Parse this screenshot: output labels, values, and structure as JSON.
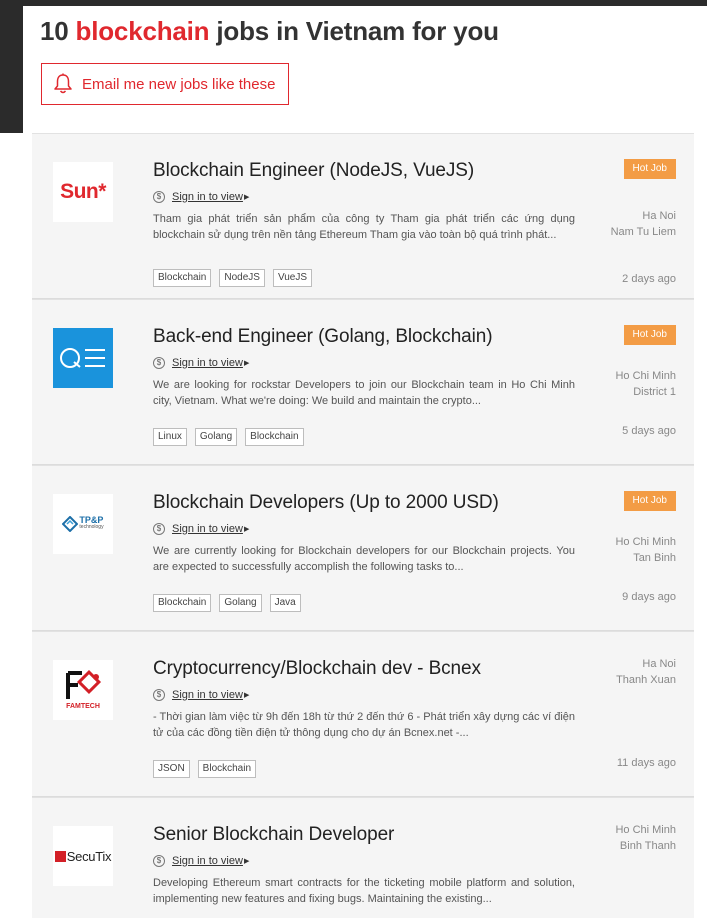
{
  "header": {
    "count_prefix": "10 ",
    "keyword": "blockchain",
    "suffix": " jobs in Vietnam for you",
    "email_button": "Email me new jobs like these"
  },
  "jobs": [
    {
      "title": "Blockchain Engineer (NodeJS, VueJS)",
      "salary": "Sign in to view",
      "description": "Tham gia phát triển sản phẩm của công ty Tham gia phát triển các ứng dụng blockchain sử dụng trên nền tảng Ethereum Tham gia vào toàn bộ quá trình phát...",
      "tags": [
        "Blockchain",
        "NodeJS",
        "VueJS"
      ],
      "hot": "Hot Job",
      "city": "Ha Noi",
      "district": "Nam Tu Liem",
      "posted": "2 days ago",
      "logo_text": "Sun*"
    },
    {
      "title": "Back-end Engineer (Golang, Blockchain)",
      "salary": "Sign in to view",
      "description": "We are looking for rockstar Developers to join our Blockchain team in Ho Chi Minh city, Vietnam. What we're doing:  We build and maintain the crypto...",
      "tags": [
        "Linux",
        "Golang",
        "Blockchain"
      ],
      "hot": "Hot Job",
      "city": "Ho Chi Minh",
      "district": "District 1",
      "posted": "5 days ago",
      "logo_text": "QE"
    },
    {
      "title": "Blockchain Developers (Up to 2000 USD)",
      "salary": "Sign in to view",
      "description": "We are currently looking for Blockchain developers for our Blockchain projects. You are expected to successfully accomplish the following tasks to...",
      "tags": [
        "Blockchain",
        "Golang",
        "Java"
      ],
      "hot": "Hot Job",
      "city": "Ho Chi Minh",
      "district": "Tan Binh",
      "posted": "9 days ago",
      "logo_text": "TP&P",
      "logo_sub": "technology"
    },
    {
      "title": "Cryptocurrency/Blockchain dev - Bcnex",
      "salary": "Sign in to view",
      "description": "- Thời gian làm việc từ 9h đến 18h từ thứ 2 đến thứ 6 - Phát triển xây dựng các ví điện tử của các đồng tiền điện tử thông dụng cho dự án Bcnex.net -...",
      "tags": [
        "JSON",
        "Blockchain"
      ],
      "city": "Ha Noi",
      "district": "Thanh Xuan",
      "posted": "11 days ago",
      "logo_text": "FAMTECH"
    },
    {
      "title": "Senior Blockchain Developer",
      "salary": "Sign in to view",
      "description": "Developing Ethereum smart contracts for the ticketing mobile platform and solution, implementing new features and fixing bugs. Maintaining the existing...",
      "tags": [],
      "city": "Ho Chi Minh",
      "district": "Binh Thanh",
      "posted": "",
      "logo_text": "SecuTix"
    }
  ],
  "colors": {
    "accent": "#e0282e",
    "hot_badge": "#f39c45"
  }
}
